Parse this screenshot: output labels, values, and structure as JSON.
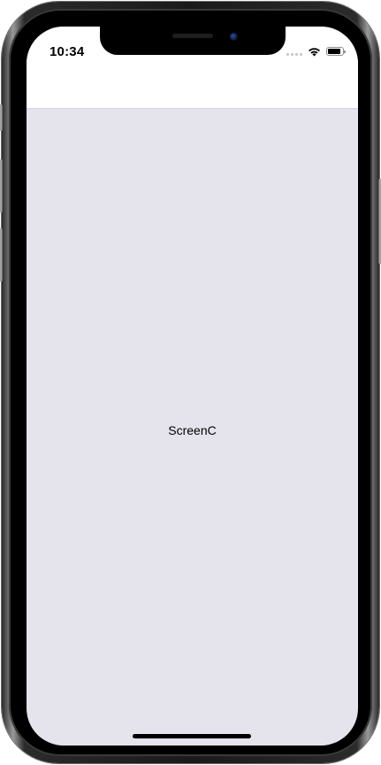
{
  "status_bar": {
    "time": "10:34",
    "battery_level": 0.9,
    "signal_icon": "cellular-signal-icon",
    "wifi_icon": "wifi-icon",
    "battery_icon": "battery-icon"
  },
  "screen": {
    "label": "ScreenC",
    "background_color": "#e5e3ec",
    "header_color": "#ffffff"
  }
}
